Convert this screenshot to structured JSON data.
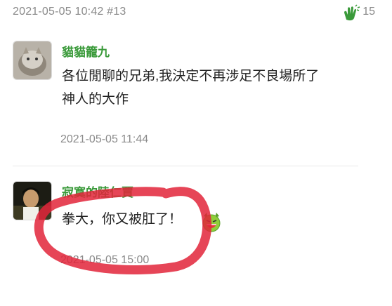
{
  "post": {
    "meta": "2021-05-05 10:42 #13",
    "claps_icon": "clapping-hands-icon",
    "clap_count": "15"
  },
  "comments": [
    {
      "author": "貓貓籠九",
      "lines": [
        "各位閒聊的兄弟,我決定不再涉足不良場所了",
        "神人的大作"
      ],
      "time": "2021-05-05 11:44",
      "avatar": "cat-avatar"
    },
    {
      "author": "寂寞的陸仁賈",
      "lines": [
        "拳大，你又被肛了！"
      ],
      "emoji": "devil-grin-emoji",
      "time": "2021-05-05 15:00",
      "avatar": "person-avatar"
    }
  ],
  "colors": {
    "author": "#3a9a3a",
    "meta": "#8a8a8a",
    "highlight": "#e2253a"
  }
}
